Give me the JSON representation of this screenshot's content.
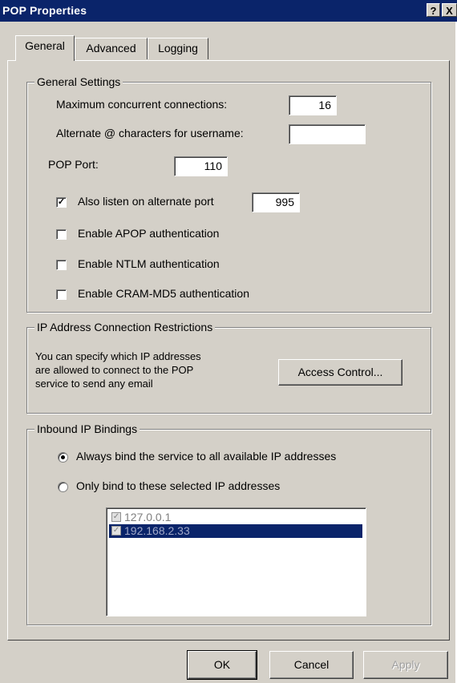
{
  "window": {
    "title": "POP Properties",
    "help_glyph": "?",
    "close_glyph": "X"
  },
  "tabs": [
    {
      "label": "General",
      "active": true
    },
    {
      "label": "Advanced",
      "active": false
    },
    {
      "label": "Logging",
      "active": false
    }
  ],
  "general_settings": {
    "title": "General Settings",
    "max_connections_label": "Maximum concurrent connections:",
    "max_connections_value": "16",
    "alt_chars_label": "Alternate @ characters for username:",
    "alt_chars_value": "",
    "pop_port_label": "POP Port:",
    "pop_port_value": "110",
    "alt_port_label": "Also listen on alternate port",
    "alt_port_checked": true,
    "alt_port_value": "995",
    "apop_label": "Enable APOP authentication",
    "apop_checked": false,
    "ntlm_label": "Enable NTLM authentication",
    "ntlm_checked": false,
    "crammd5_label": "Enable CRAM-MD5 authentication",
    "crammd5_checked": false,
    "check_glyph": "✓"
  },
  "ip_restrictions": {
    "title": "IP Address Connection Restrictions",
    "description_line1": "You can specify which IP addresses",
    "description_line2": "are allowed to connect to the POP",
    "description_line3": "service to send any email",
    "access_button": "Access Control..."
  },
  "inbound_bindings": {
    "title": "Inbound IP Bindings",
    "option_all": "Always bind the service to all available IP addresses",
    "option_selected": "Only bind to these selected IP addresses",
    "selected_option": "all",
    "addresses": [
      {
        "ip": "127.0.0.1",
        "checked": true,
        "selected": false
      },
      {
        "ip": "192.168.2.33",
        "checked": true,
        "selected": true
      }
    ]
  },
  "footer": {
    "ok": "OK",
    "cancel": "Cancel",
    "apply": "Apply"
  },
  "colors": {
    "titlebar": "#0a246a",
    "face": "#d4d0c8",
    "selection": "#0a246a"
  }
}
